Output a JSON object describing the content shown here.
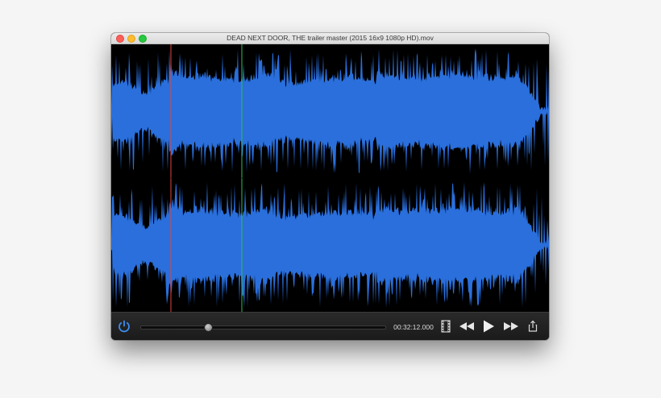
{
  "window": {
    "title": "DEAD NEXT DOOR, THE trailer master (2015 16x9 1080p HD).mov"
  },
  "waveform": {
    "channels": 2,
    "fill_color": "#2a6fdc",
    "background_color": "#000000",
    "playhead_color": "#e0453c",
    "marker_color": "#2fbf56"
  },
  "transport": {
    "timecode": "00:32:12.000",
    "progress": 0.27,
    "icons": [
      "power-icon",
      "film-icon",
      "rewind-icon",
      "play-icon",
      "fast-forward-icon",
      "share-icon"
    ]
  }
}
